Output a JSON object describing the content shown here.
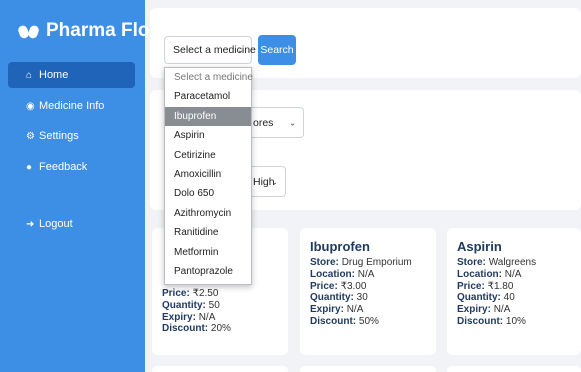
{
  "sidebar": {
    "brand": "Pharma Flow",
    "items": [
      {
        "label": "Home",
        "icon": "home-icon"
      },
      {
        "label": "Medicine Info",
        "icon": "medicine-icon"
      },
      {
        "label": "Settings",
        "icon": "gear-icon"
      },
      {
        "label": "Feedback",
        "icon": "feedback-icon"
      }
    ],
    "logout": "Logout"
  },
  "search": {
    "select_value": "Select a medicine",
    "button": "Search",
    "options": [
      "Select a medicine",
      "Paracetamol",
      "Ibuprofen",
      "Aspirin",
      "Cetirizine",
      "Amoxicillin",
      "Dolo 650",
      "Azithromycin",
      "Ranitidine",
      "Metformin",
      "Pantoprazole"
    ],
    "highlighted_option": "Ibuprofen"
  },
  "filters": {
    "store_select_partial": "ores",
    "sort_select_partial": "High"
  },
  "products": [
    {
      "name": "",
      "store": "",
      "location": "",
      "price": "₹2.50",
      "quantity": "50",
      "expiry": "N/A",
      "discount": "20%"
    },
    {
      "name": "Ibuprofen",
      "store": "Drug Emporium",
      "location": "N/A",
      "price": "₹3.00",
      "quantity": "30",
      "expiry": "N/A",
      "discount": "50%"
    },
    {
      "name": "Aspirin",
      "store": "Walgreens",
      "location": "N/A",
      "price": "₹1.80",
      "quantity": "40",
      "expiry": "N/A",
      "discount": "10%"
    }
  ],
  "labels": {
    "store": "Store:",
    "location": "Location:",
    "price": "Price:",
    "quantity": "Quantity:",
    "expiry": "Expiry:",
    "discount": "Discount:"
  },
  "colors": {
    "sidebar": "#3d8ee5",
    "active": "#1f64b8",
    "accent": "#3d8ee5",
    "highlight": "#888d93"
  }
}
